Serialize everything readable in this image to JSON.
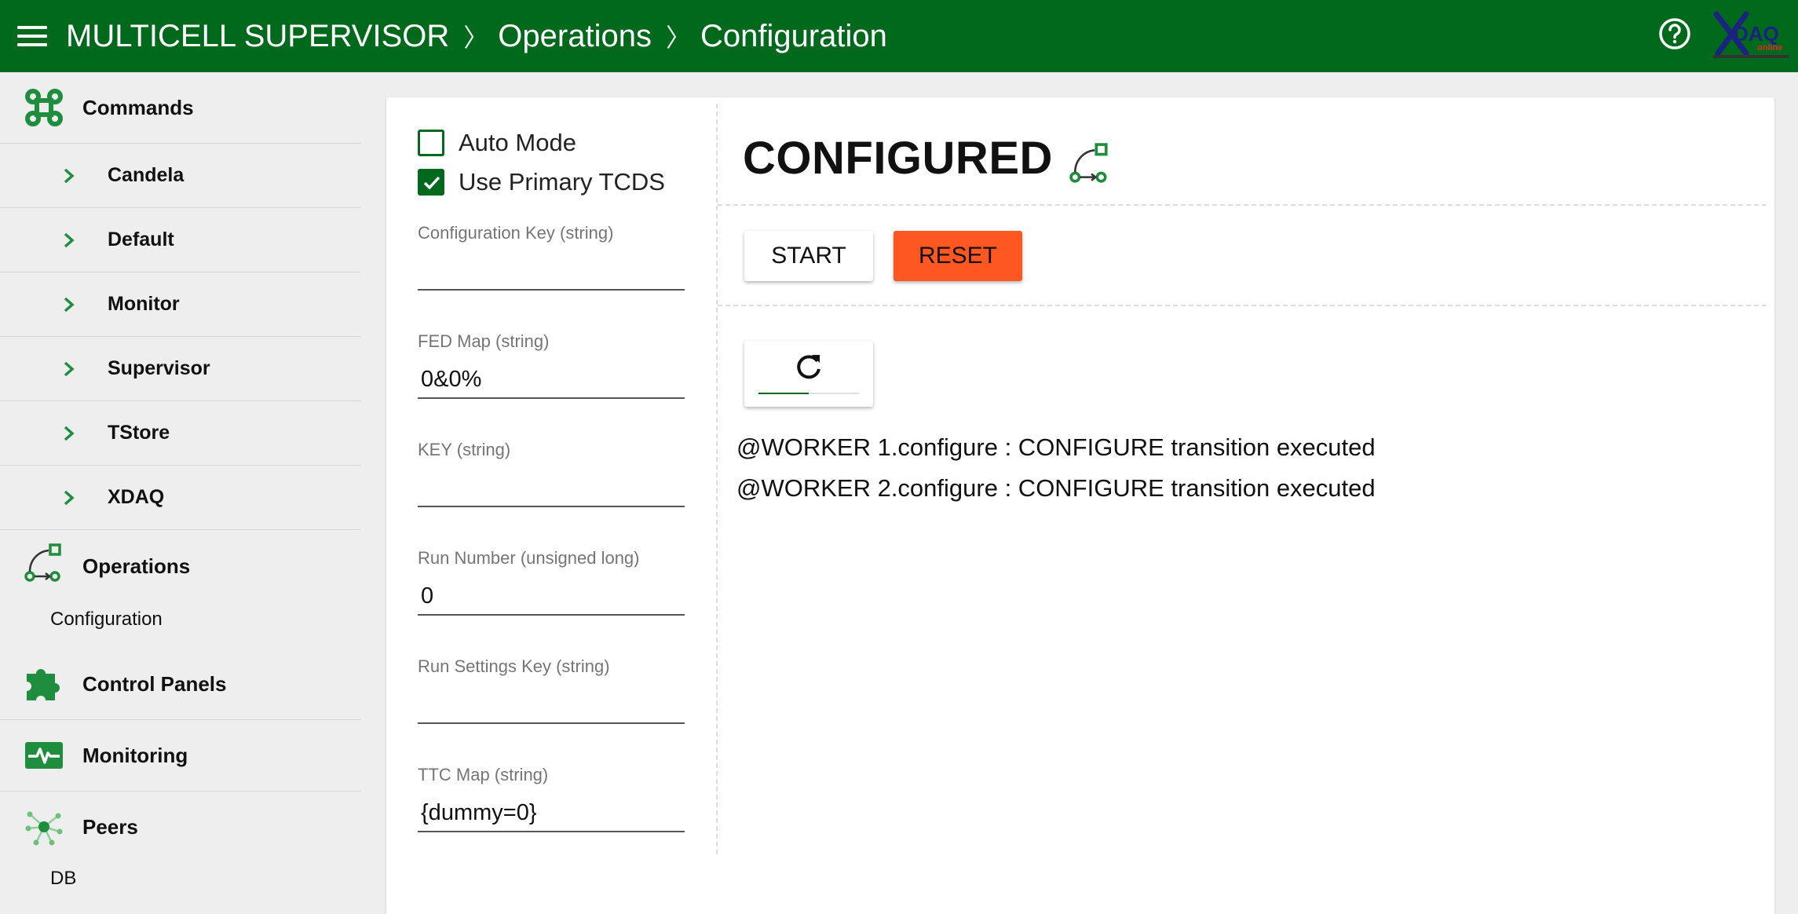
{
  "header": {
    "app_title": "MULTICELL SUPERVISOR",
    "breadcrumb": [
      "Operations",
      "Configuration"
    ],
    "separator": "〉",
    "logo_text": "XDAQ",
    "logo_sub": "online",
    "brand_color": "#00691c"
  },
  "sidebar": {
    "commands": {
      "label": "Commands",
      "icon": "command-icon",
      "items": [
        {
          "label": "Candela"
        },
        {
          "label": "Default"
        },
        {
          "label": "Monitor"
        },
        {
          "label": "Supervisor"
        },
        {
          "label": "TStore"
        },
        {
          "label": "XDAQ"
        }
      ]
    },
    "operations": {
      "label": "Operations",
      "icon": "state-machine-icon",
      "items": [
        {
          "label": "Configuration"
        }
      ]
    },
    "control_panels": {
      "label": "Control Panels",
      "icon": "puzzle-icon"
    },
    "monitoring": {
      "label": "Monitoring",
      "icon": "heartbeat-monitor-icon"
    },
    "peers": {
      "label": "Peers",
      "icon": "network-hub-icon",
      "items": [
        {
          "label": "DB"
        }
      ]
    }
  },
  "form": {
    "auto_mode": {
      "label": "Auto Mode",
      "checked": false
    },
    "use_primary_tcds": {
      "label": "Use Primary TCDS",
      "checked": true
    },
    "fields": [
      {
        "label": "Configuration Key (string)",
        "value": ""
      },
      {
        "label": "FED Map (string)",
        "value": "0&0%"
      },
      {
        "label": "KEY (string)",
        "value": ""
      },
      {
        "label": "Run Number (unsigned long)",
        "value": "0"
      },
      {
        "label": "Run Settings Key (string)",
        "value": ""
      },
      {
        "label": "TTC Map (string)",
        "value": "{dummy=0}"
      }
    ]
  },
  "status": {
    "state": "CONFIGURED",
    "state_icon": "state-machine-icon",
    "buttons": {
      "start": "START",
      "reset": "RESET"
    },
    "reset_color": "#ff5722",
    "refresh_icon": "refresh-icon",
    "refresh_progress": 0.5,
    "log": [
      "@WORKER 1.configure : CONFIGURE transition executed",
      "@WORKER 2.configure : CONFIGURE transition executed"
    ]
  }
}
